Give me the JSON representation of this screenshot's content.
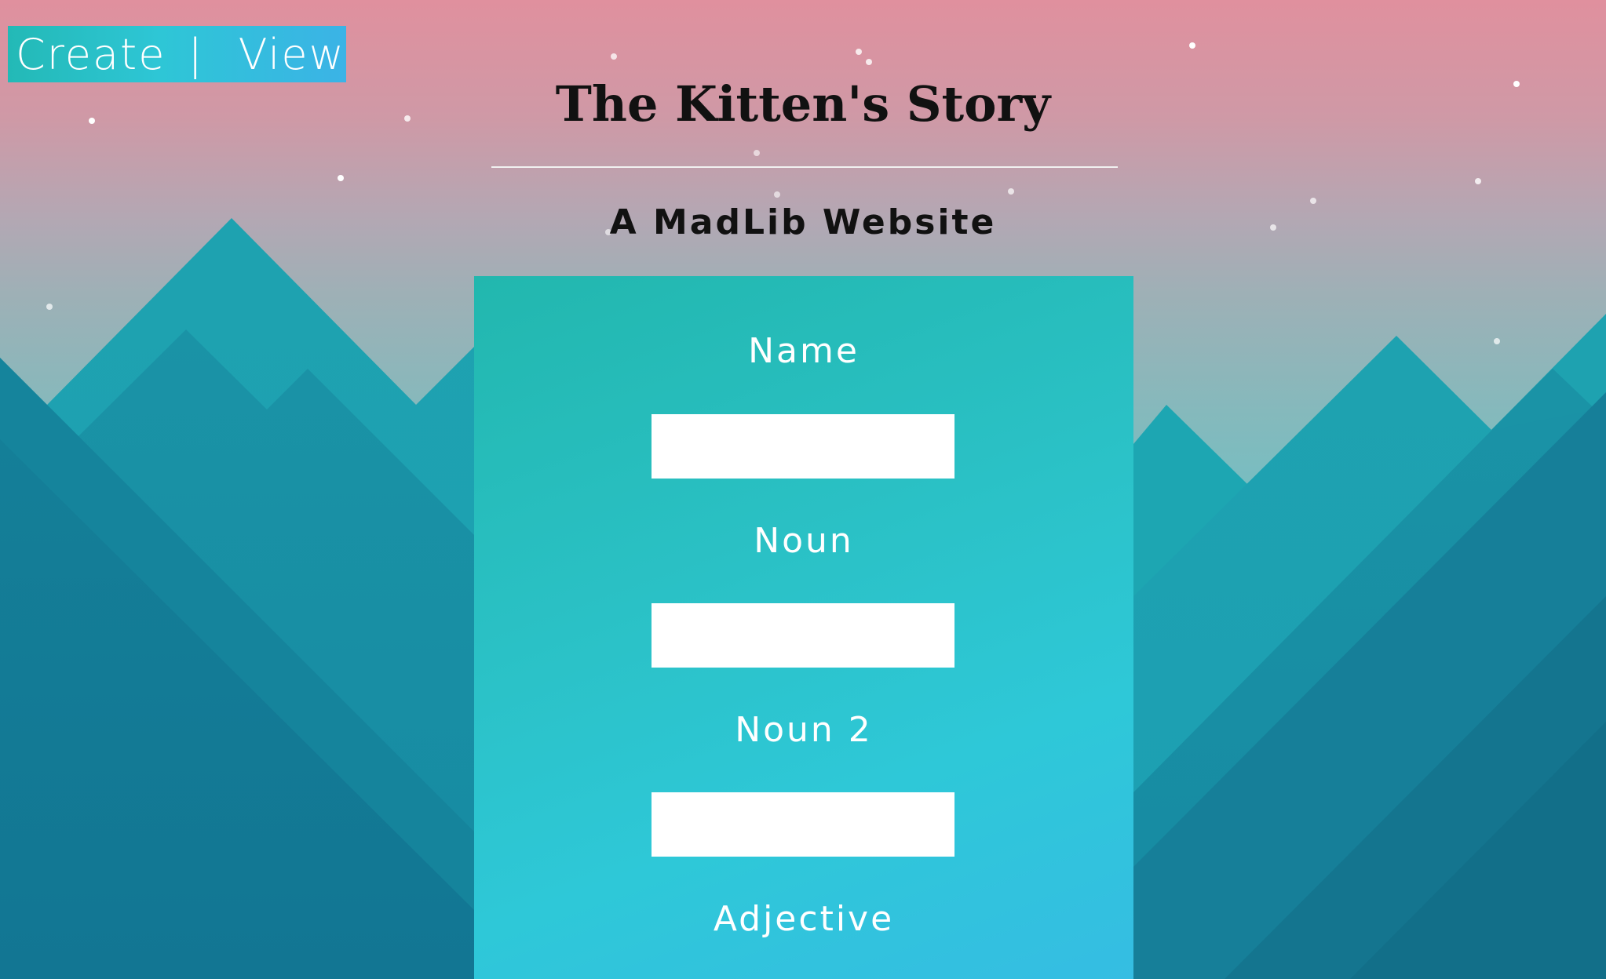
{
  "nav": {
    "create_label": "Create",
    "separator": "|",
    "view_label": "View"
  },
  "page": {
    "title": "The Kitten's Story",
    "subtitle": "A MadLib Website"
  },
  "form": {
    "fields": [
      {
        "label": "Name",
        "value": "",
        "placeholder": ""
      },
      {
        "label": "Noun",
        "value": "",
        "placeholder": ""
      },
      {
        "label": "Noun 2",
        "value": "",
        "placeholder": ""
      },
      {
        "label": "Adjective"
      }
    ]
  },
  "colors": {
    "sky_top": "#e0909e",
    "mountain_dark": "#127b97",
    "panel_accent": "#2bc2c8",
    "nav_accent": "#2ec6d6"
  }
}
